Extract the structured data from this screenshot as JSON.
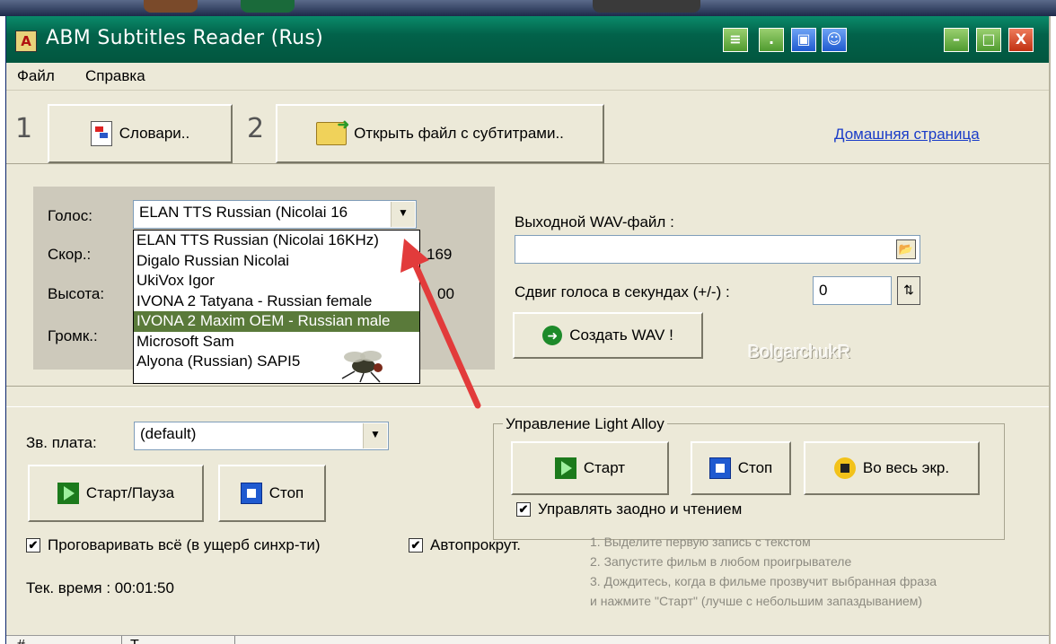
{
  "window": {
    "title": "ABM Subtitles Reader (Rus)",
    "app_icon_glyph": "A",
    "controls": {
      "minimize": "–",
      "maximize": "□",
      "close": "X"
    }
  },
  "menu": {
    "file": "Файл",
    "help": "Справка"
  },
  "toolbar": {
    "step1": "1",
    "step2": "2",
    "dictionaries_label": "Словари..",
    "open_subtitles_label": "Открыть файл с субтитрами..",
    "homepage_link": "Домашняя страница"
  },
  "voice": {
    "voice_label": "Голос:",
    "voice_value": "ELAN TTS Russian (Nicolai 16",
    "rate_label": "Скор.:",
    "rate_value": "169",
    "pitch_label": "Высота:",
    "pitch_value": "00",
    "volume_label": "Громк.:",
    "options": [
      "ELAN TTS Russian (Nicolai 16KHz)",
      "Digalo Russian Nicolai",
      "UkiVox Igor",
      "IVONA 2 Tatyana - Russian female",
      "IVONA 2 Maxim OEM - Russian male",
      "Microsoft Sam",
      "Alyona (Russian) SAPI5"
    ],
    "highlighted_index": 4
  },
  "output": {
    "wav_label": "Выходной WAV-файл :",
    "wav_value": "",
    "shift_label": "Сдвиг голоса в секундах (+/-) :",
    "shift_value": "0",
    "create_wav_label": "Создать WAV !",
    "watermark": "BolgarchukR"
  },
  "sound": {
    "card_label": "Зв. плата:",
    "card_value": "(default)",
    "start_pause_label": "Старт/Пауза",
    "stop_label": "Стоп"
  },
  "light_alloy": {
    "group_title": "Управление Light Alloy",
    "start_label": "Старт",
    "stop_label": "Стоп",
    "fullscreen_label": "Во весь экр.",
    "sync_reading_label": "Управлять заодно и чтением",
    "sync_reading_checked": true
  },
  "options": {
    "speak_all_label": "Проговаривать всё (в ущерб синхр-ти)",
    "speak_all_checked": true,
    "autoscroll_label": "Автопрокрут.",
    "autoscroll_checked": true
  },
  "status": {
    "current_time": "Тек. время : 00:01:50"
  },
  "hints": [
    "1. Выделите первую запись с текстом",
    "2. Запустите фильм в любом проигрывателе",
    "3. Дождитесь, когда в фильме прозвучит выбранная фраза",
    "и нажмите \"Старт\" (лучше с небольшим запаздыванием)"
  ],
  "grid": {
    "col1": "#",
    "col2": "T"
  },
  "colors": {
    "accent_arrow": "#e23b3b",
    "title_bar": "#02624a",
    "selected_item": "#5a7a3a"
  }
}
